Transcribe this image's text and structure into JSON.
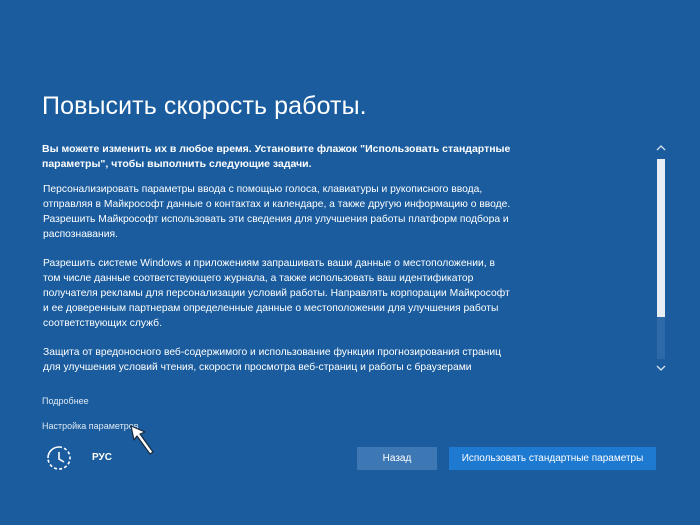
{
  "page": {
    "title": "Повысить скорость работы.",
    "lead": "Вы можете изменить их в любое время. Установите флажок \"Использовать стандартные параметры\", чтобы выполнить следующие задачи.",
    "paragraphs": [
      "Персонализировать параметры ввода с помощью голоса, клавиатуры и рукописного ввода, отправляя в Майкрософт данные о контактах и календаре, а также другую информацию о вводе. Разрешить Майкрософт использовать эти сведения для улучшения работы платформ подбора и распознавания.",
      "Разрешить системе Windows и приложениям запрашивать ваши данные о местоположении, в том числе данные соответствующего журнала, а также использовать ваш идентификатор получателя рекламы для персонализации условий работы. Направлять корпорации Майкрософт и ее доверенным партнерам определенные данные о местоположении для улучшения работы соответствующих служб.",
      "Защита от вредоносного веб-содержимого и использование функции прогнозирования страниц для улучшения условий чтения, скорости просмотра веб-страниц и работы с браузерами Windows в целом. Данные о просмотрах в сети отправляются в Майкрософт."
    ]
  },
  "links": {
    "more": "Подробнее",
    "customize": "Настройка параметров"
  },
  "footer": {
    "language": "РУС",
    "back_label": "Назад",
    "express_label": "Использовать стандартные параметры"
  },
  "scroll": {
    "position": 0
  },
  "icons": {
    "scroll_up": "chevron-up-icon",
    "scroll_down": "chevron-down-icon",
    "accessibility": "ease-of-access-icon",
    "pointer": "mouse-pointer-icon"
  },
  "colors": {
    "background": "#1a5c9e",
    "primary_button": "#1e7ad1",
    "secondary_button": "#3d78b5"
  }
}
